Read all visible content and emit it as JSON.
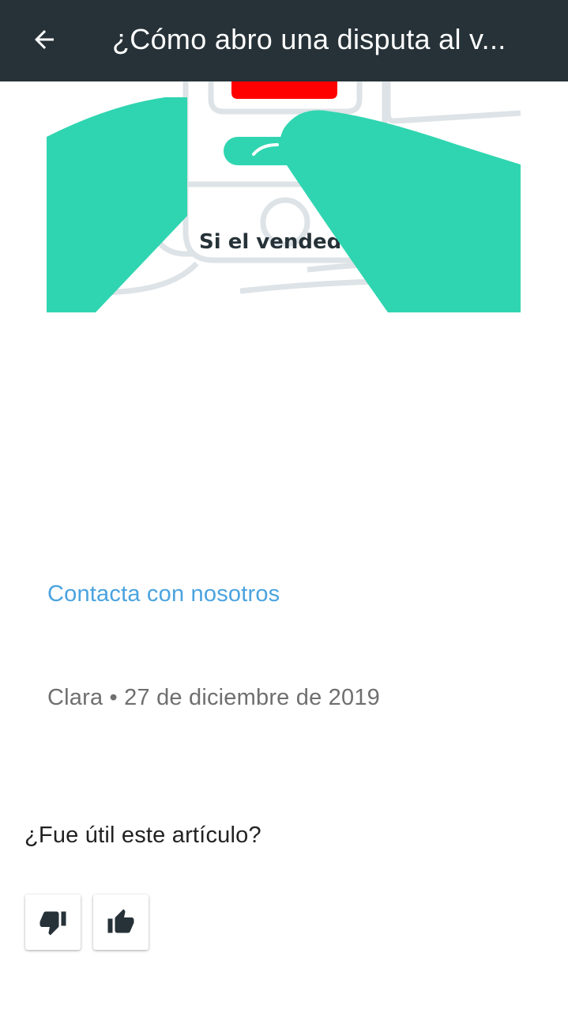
{
  "header": {
    "back_icon": "arrow-left-icon",
    "title": "¿Cómo abro una disputa al v..."
  },
  "illustration": {
    "caption": "Si el vendedor",
    "colors": {
      "hand": "#2fd5b0",
      "button": "#ff0000",
      "outline": "#dde3e6"
    }
  },
  "links": {
    "contact": "Contacta con nosotros"
  },
  "article": {
    "meta": "Clara • 27 de diciembre de 2019"
  },
  "feedback": {
    "question": "¿Fue útil este artículo?",
    "buttons": [
      {
        "icon": "thumbs-down-icon"
      },
      {
        "icon": "thumbs-up-icon"
      }
    ]
  },
  "theme": {
    "toolbar": "#263238",
    "link": "#4aa3df"
  }
}
